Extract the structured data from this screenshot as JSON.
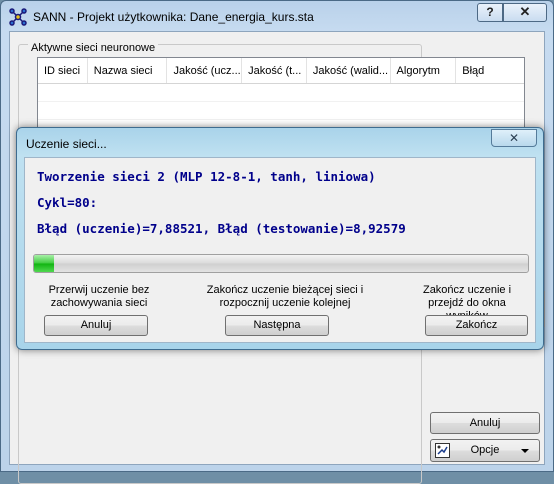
{
  "main_window": {
    "title": "SANN - Projekt użytkownika: Dane_energia_kurs.sta",
    "help_button": "?",
    "close_button": "✕",
    "group_label": "Aktywne sieci neuronowe",
    "grid_columns": [
      "ID sieci",
      "Nazwa sieci",
      "Jakość (ucz...",
      "Jakość (t...",
      "Jakość (walid...",
      "Algorytm",
      "Błąd"
    ],
    "cancel_label": "Anuluj",
    "options_label": "Opcje"
  },
  "dialog": {
    "title": "Uczenie sieci...",
    "close_button": "✕",
    "status_line1": "Tworzenie sieci 2 (MLP 12-8-1, tanh, liniowa)",
    "status_line2": "Cykl=80:",
    "status_line3": "Błąd (uczenie)=7,88521, Błąd (testowanie)=8,92579",
    "progress_fraction": 0.04,
    "desc_abort": "Przerwij uczenie bez zachowywania sieci",
    "desc_next": "Zakończ uczenie bieżącej sieci i rozpocznij uczenie kolejnej",
    "desc_finish": "Zakończ uczenie i przejdź do okna wyników",
    "btn_abort": "Anuluj",
    "btn_next": "Następna",
    "btn_finish": "Zakończ"
  },
  "colors": {
    "status_text": "#00008b",
    "progress_green": "#10b310",
    "dialog_frame": "#a9d3ea"
  },
  "icons": [
    "app-icon",
    "options-icon",
    "chevron-down-icon",
    "close-icon",
    "help-icon"
  ]
}
